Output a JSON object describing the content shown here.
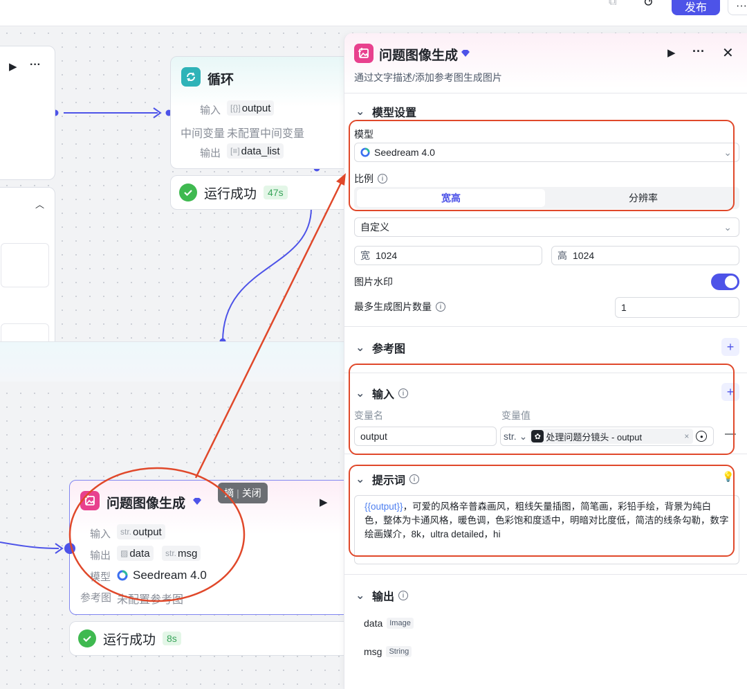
{
  "topbar": {
    "publish_label": "发布",
    "more_label": "···"
  },
  "node_top": {
    "more": "···"
  },
  "loop_node": {
    "title": "循环",
    "rows": [
      {
        "label": "输入",
        "prefix": "[{}]",
        "value": "output"
      },
      {
        "label": "中间变量",
        "value": "未配置中间变量"
      },
      {
        "label": "输出",
        "prefix": "[≡]",
        "value": "data_list"
      }
    ],
    "status": "运行成功",
    "duration": "47s"
  },
  "image_node": {
    "title": "问题图像生成",
    "input_label": "输入",
    "input_prefix": "str.",
    "input_value": "output",
    "output_label": "输出",
    "output_data": "data",
    "output_prefix": "str.",
    "output_msg": "msg",
    "model_label": "模型",
    "model_value": "Seedream 4.0",
    "ref_label": "参考图",
    "ref_value": "未配置参考图",
    "status": "运行成功",
    "duration": "8s",
    "tooltip_left": "摘",
    "tooltip_right": "关闭"
  },
  "panel": {
    "title": "问题图像生成",
    "subtitle": "通过文字描述/添加参考图生成图片",
    "more": "···",
    "model_section": "模型设置",
    "model_label": "模型",
    "model_value": "Seedream 4.0",
    "ratio_label": "比例",
    "ratio_tabs": [
      "宽高",
      "分辨率"
    ],
    "size_preset": "自定义",
    "width_label": "宽",
    "width_value": "1024",
    "height_label": "高",
    "height_value": "1024",
    "watermark_label": "图片水印",
    "watermark_on": true,
    "max_count_label": "最多生成图片数量",
    "max_count_value": "1",
    "ref_section": "参考图",
    "input_section": "输入",
    "var_name_header": "变量名",
    "var_value_header": "变量值",
    "var_name": "output",
    "var_type": "str.",
    "var_ref": "处理问题分镜头 - output",
    "prompt_section": "提示词",
    "prompt_var": "{{output}}",
    "prompt_text": "，可爱的风格辛普森画风，粗线矢量插图，简笔画，彩铅手绘，背景为纯白色，整体为卡通风格，暖色调，色彩饱和度适中，明暗对比度低，简洁的线条勾勒，数字绘画媒介，8k，ultra detailed，hi",
    "output_section": "输出",
    "outputs": [
      {
        "name": "data",
        "type": "Image"
      },
      {
        "name": "msg",
        "type": "String"
      }
    ]
  },
  "colors": {
    "accent": "#4d53e8",
    "annotation": "#e0482a",
    "success": "#3fb950"
  }
}
